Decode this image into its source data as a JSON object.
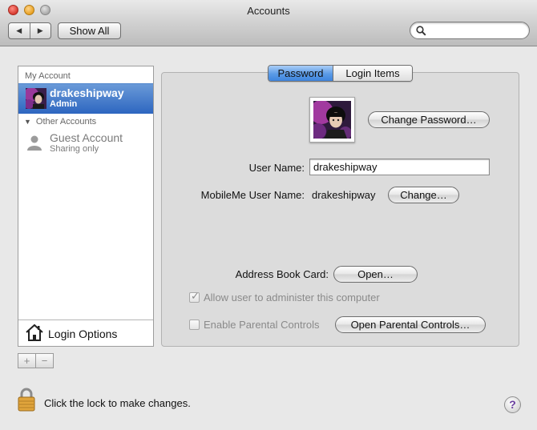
{
  "window": {
    "title": "Accounts"
  },
  "toolbar": {
    "back_glyph": "◀",
    "forward_glyph": "▶",
    "show_all_label": "Show All",
    "search_value": "",
    "search_placeholder": ""
  },
  "sidebar": {
    "my_account_header": "My Account",
    "selected_user": {
      "name": "drakeshipway",
      "role": "Admin"
    },
    "other_accounts_header": "Other Accounts",
    "guest": {
      "name": "Guest Account",
      "subtitle": "Sharing only"
    },
    "login_options_label": "Login Options",
    "add_glyph": "+",
    "remove_glyph": "−"
  },
  "tabs": [
    {
      "label": "Password",
      "active": true
    },
    {
      "label": "Login Items",
      "active": false
    }
  ],
  "password_pane": {
    "change_password_label": "Change Password…",
    "user_name_label": "User Name:",
    "user_name_value": "drakeshipway",
    "mobileme_label": "MobileMe User Name:",
    "mobileme_value": "drakeshipway",
    "mobileme_change_label": "Change…",
    "address_book_label": "Address Book Card:",
    "address_book_open_label": "Open…",
    "admin_checkbox_label": "Allow user to administer this computer",
    "admin_checked": true,
    "parental_checkbox_label": "Enable Parental Controls",
    "parental_checked": false,
    "parental_open_label": "Open Parental Controls…"
  },
  "footer": {
    "lock_text": "Click the lock to make changes.",
    "help_glyph": "?"
  },
  "colors": {
    "selection": "#2d66c0",
    "tab_active": "#5a9ae6",
    "help": "#6b3fa0",
    "lock": "#d9a33a"
  }
}
